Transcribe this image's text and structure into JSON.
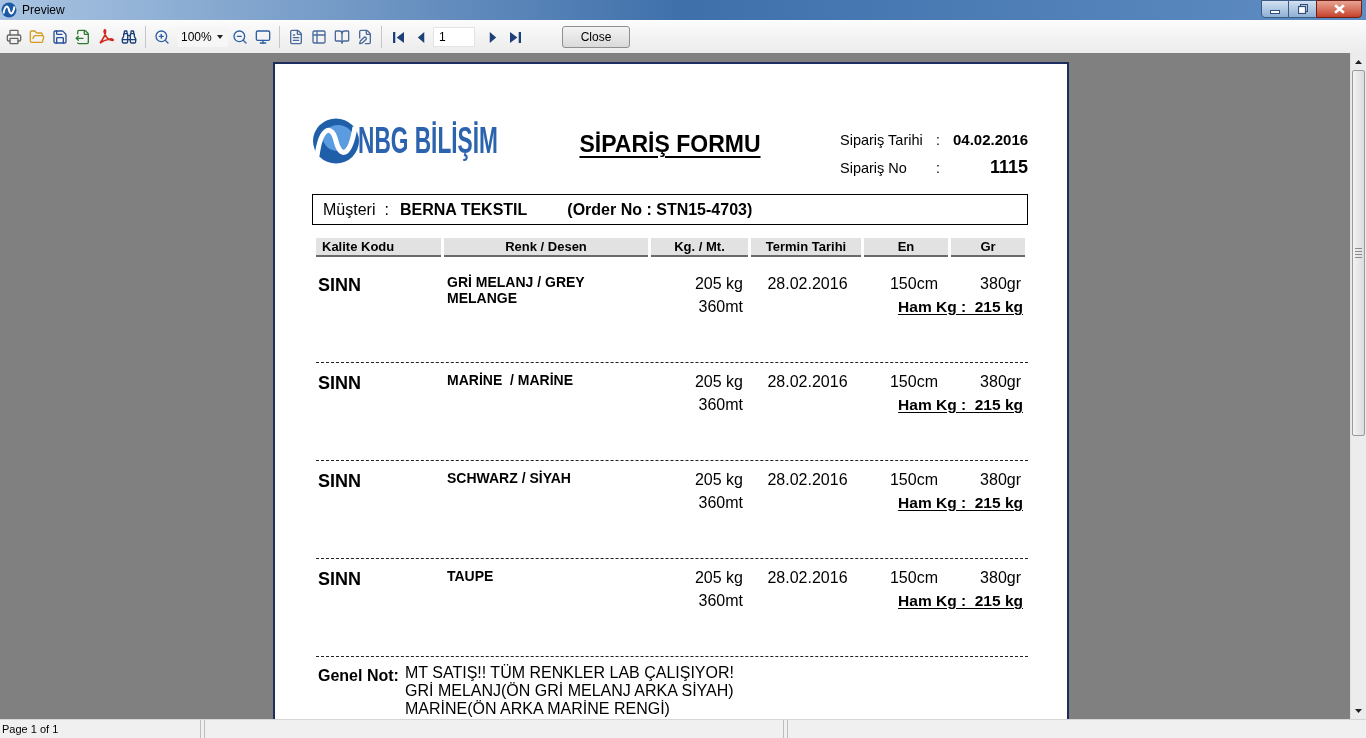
{
  "window": {
    "title": "Preview"
  },
  "toolbar": {
    "zoom": "100%",
    "page_field": "1",
    "close_button": "Close"
  },
  "document": {
    "logo_text": "NBG BİLİŞİM",
    "title": "SİPARİŞ FORMU",
    "meta": [
      {
        "label": "Sipariş Tarihi",
        "separator": ":",
        "value": "04.02.2016"
      },
      {
        "label": "Sipariş No",
        "separator": ":",
        "value": "1115"
      }
    ],
    "customer": {
      "label": "Müşteri",
      "separator": ":",
      "name": "BERNA TEKSTIL",
      "order_no": "(Order No : STN15-4703)"
    },
    "columns": [
      "Kalite Kodu",
      "Renk / Desen",
      "Kg. / Mt.",
      "Termin Tarihi",
      "En",
      "Gr"
    ],
    "rows": [
      {
        "kalite_kodu": "SINN",
        "renk_desen": "GRİ MELANJ / GREY MELANGE",
        "kg": "205 kg",
        "mt": "360mt",
        "termin_tarihi": "28.02.2016",
        "en": "150cm",
        "gr": "380gr",
        "ham_kg": "Ham Kg :  215 kg"
      },
      {
        "kalite_kodu": "SINN",
        "renk_desen": "MARİNE  / MARİNE",
        "kg": "205 kg",
        "mt": "360mt",
        "termin_tarihi": "28.02.2016",
        "en": "150cm",
        "gr": "380gr",
        "ham_kg": "Ham Kg :  215 kg"
      },
      {
        "kalite_kodu": "SINN",
        "renk_desen": "SCHWARZ / SİYAH",
        "kg": "205 kg",
        "mt": "360mt",
        "termin_tarihi": "28.02.2016",
        "en": "150cm",
        "gr": "380gr",
        "ham_kg": "Ham Kg :  215 kg"
      },
      {
        "kalite_kodu": "SINN",
        "renk_desen": "TAUPE",
        "kg": "205 kg",
        "mt": "360mt",
        "termin_tarihi": "28.02.2016",
        "en": "150cm",
        "gr": "380gr",
        "ham_kg": "Ham Kg :  215 kg"
      }
    ],
    "note": {
      "label": "Genel Not:",
      "lines": [
        "MT SATIŞ!! TÜM RENKLER LAB ÇALIŞIYOR!",
        "GRİ MELANJ(ÖN GRİ MELANJ ARKA SİYAH)",
        "MARİNE(ÖN ARKA MARİNE RENGİ)"
      ]
    }
  },
  "status_bar": {
    "page": "Page 1 of 1"
  }
}
